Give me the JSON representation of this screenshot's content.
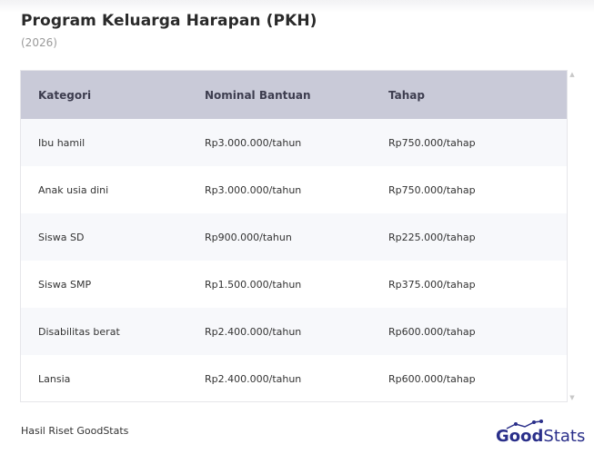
{
  "header": {
    "title": "Program Keluarga Harapan (PKH)",
    "subtitle": "(2026)"
  },
  "chart_data": {
    "type": "table",
    "columns": [
      "Kategori",
      "Nominal Bantuan",
      "Tahap"
    ],
    "rows": [
      [
        "Ibu hamil",
        "Rp3.000.000/tahun",
        "Rp750.000/tahap"
      ],
      [
        "Anak usia dini",
        "Rp3.000.000/tahun",
        "Rp750.000/tahap"
      ],
      [
        "Siswa SD",
        "Rp900.000/tahun",
        "Rp225.000/tahap"
      ],
      [
        "Siswa SMP",
        "Rp1.500.000/tahun",
        "Rp375.000/tahap"
      ],
      [
        "Disabilitas berat",
        "Rp2.400.000/tahun",
        "Rp600.000/tahap"
      ],
      [
        "Lansia",
        "Rp2.400.000/tahun",
        "Rp600.000/tahap"
      ]
    ]
  },
  "footer": {
    "source": "Hasil Riset GoodStats",
    "logo_bold": "Good",
    "logo_light": "Stats"
  },
  "colors": {
    "header_bg": "#c9cad8",
    "logo": "#2a2f8a"
  },
  "icons": [
    "scroll-up-icon",
    "scroll-down-icon",
    "goodstats-logo"
  ]
}
